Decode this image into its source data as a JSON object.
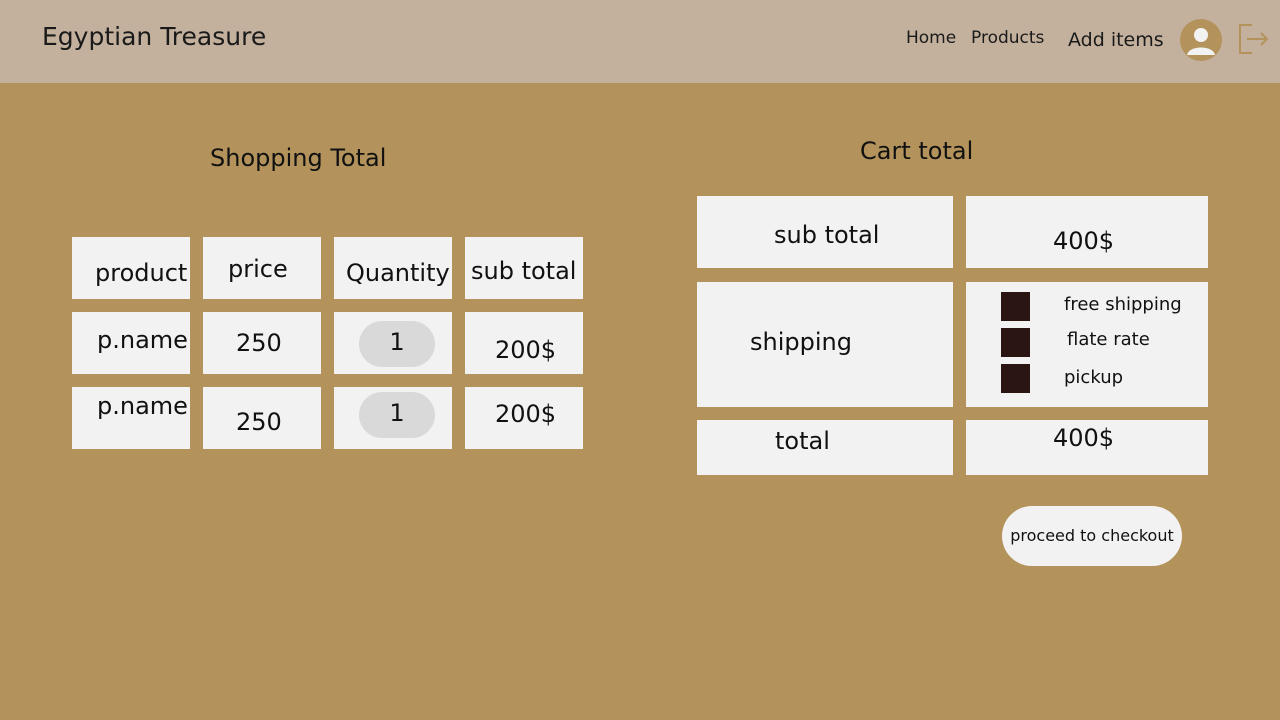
{
  "header": {
    "brand": "Egyptian Treasure",
    "nav": {
      "home": "Home",
      "products": "Products",
      "add_items": "Add items"
    }
  },
  "shopping": {
    "title": "Shopping Total",
    "columns": [
      "product",
      "price",
      "Quantity",
      "sub total"
    ],
    "rows": [
      {
        "name": "p.name",
        "price": "250",
        "quantity": "1",
        "subtotal": "200$"
      },
      {
        "name": "p.name",
        "price": "250",
        "quantity": "1",
        "subtotal": "200$"
      }
    ]
  },
  "cart": {
    "title": "Cart total",
    "subtotal_label": "sub total",
    "subtotal_value": "400$",
    "shipping_label": "shipping",
    "shipping_options": [
      "free shipping",
      "flate rate",
      "pickup"
    ],
    "total_label": "total",
    "total_value": "400$",
    "checkout_label": "proceed to checkout"
  },
  "colors": {
    "background": "#b3935b",
    "header": "#c3b19d",
    "cell": "#f2f2f2",
    "pill": "#d9d9d9",
    "checkbox": "#2a1512"
  }
}
